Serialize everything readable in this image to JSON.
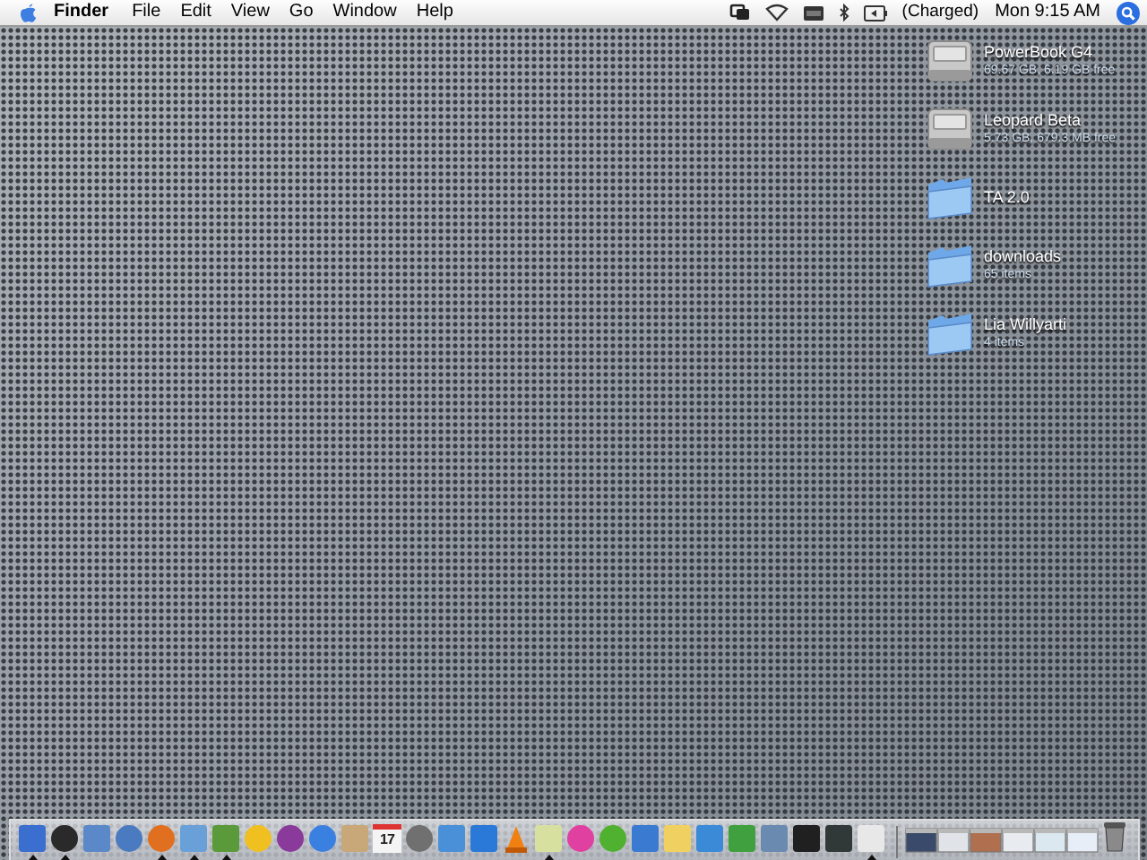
{
  "menu_bar": {
    "app": "Finder",
    "menus": [
      "File",
      "Edit",
      "View",
      "Go",
      "Window",
      "Help"
    ],
    "battery": "(Charged)",
    "clock": "Mon 9:15 AM"
  },
  "desktop_items": [
    {
      "kind": "drive",
      "name": "PowerBook G4",
      "info": "69.67 GB, 6.19 GB free"
    },
    {
      "kind": "drive",
      "name": "Leopard Beta",
      "info": "5.73 GB, 679.3 MB free"
    },
    {
      "kind": "folder",
      "name": "TA 2.0"
    },
    {
      "kind": "folder",
      "name": "downloads",
      "info": "65 items"
    },
    {
      "kind": "folder",
      "name": "Lia Willyarti",
      "info": "4 items"
    }
  ],
  "dock": {
    "apps": [
      {
        "kind": "square",
        "color": "#3a6fd0",
        "running": true
      },
      {
        "kind": "circle",
        "color": "#2a2a2a",
        "running": true
      },
      {
        "kind": "square",
        "color": "#5b88c8",
        "running": false
      },
      {
        "kind": "circle",
        "color": "#4a7ac0",
        "running": false
      },
      {
        "kind": "circle",
        "color": "#e07020",
        "running": true
      },
      {
        "kind": "square",
        "color": "#6aa0d8",
        "running": true
      },
      {
        "kind": "square",
        "color": "#5a9a3a",
        "running": true
      },
      {
        "kind": "circle",
        "color": "#f0c020",
        "running": false
      },
      {
        "kind": "circle",
        "color": "#8a3a9a",
        "running": false
      },
      {
        "kind": "circle",
        "color": "#3a80e0",
        "running": false
      },
      {
        "kind": "square",
        "color": "#c8a878",
        "running": false
      },
      {
        "kind": "calendar",
        "color": "#f4f4f4",
        "date": "17",
        "running": false
      },
      {
        "kind": "circle",
        "color": "#707070",
        "running": false
      },
      {
        "kind": "square",
        "color": "#4a90d8",
        "running": false
      },
      {
        "kind": "square",
        "color": "#2a78d8",
        "running": false
      },
      {
        "kind": "cone",
        "color": "#f08010",
        "running": false
      },
      {
        "kind": "square",
        "color": "#d8e0a0",
        "running": true
      },
      {
        "kind": "circle",
        "color": "#e040a0",
        "running": false
      },
      {
        "kind": "circle",
        "color": "#50b030",
        "running": false
      },
      {
        "kind": "square",
        "color": "#3a7ad0",
        "running": false
      },
      {
        "kind": "square",
        "color": "#f0d060",
        "running": false
      },
      {
        "kind": "square",
        "color": "#3a8ad8",
        "running": false
      },
      {
        "kind": "square",
        "color": "#40a040",
        "running": false
      },
      {
        "kind": "square",
        "color": "#6a8ab0",
        "running": false
      },
      {
        "kind": "square",
        "color": "#202020",
        "running": false
      },
      {
        "kind": "square",
        "color": "#303838",
        "running": false
      },
      {
        "kind": "square",
        "color": "#e8e8e8",
        "running": true
      }
    ],
    "windows": [
      {
        "color": "#3a4a6a"
      },
      {
        "color": "#e0e4e8"
      },
      {
        "color": "#b07050"
      },
      {
        "color": "#e8ecf0"
      },
      {
        "color": "#dce8f0"
      },
      {
        "color": "#e8eef8"
      }
    ],
    "trash": {
      "full": false
    }
  }
}
